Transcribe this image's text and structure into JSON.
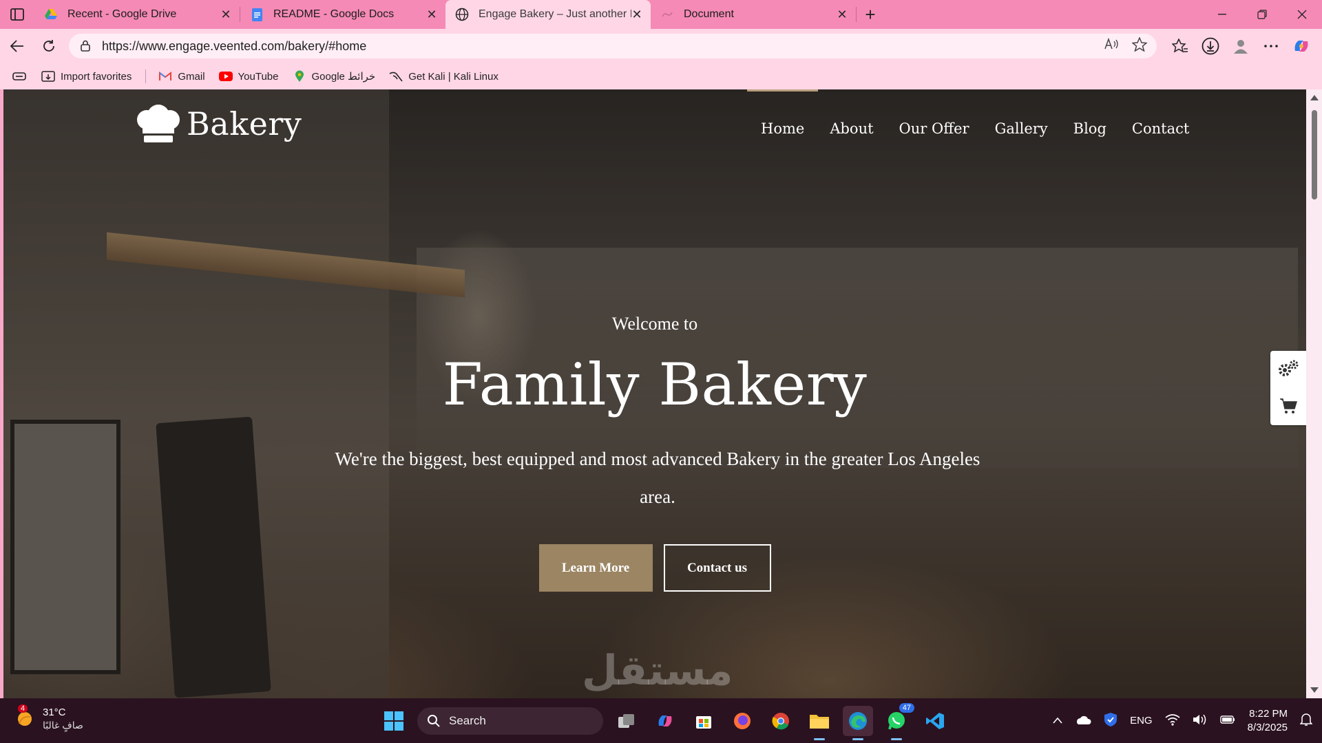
{
  "browser": {
    "tabs": [
      {
        "title": "Recent - Google Drive",
        "icon": "google-drive-icon",
        "active": false
      },
      {
        "title": "README - Google Docs",
        "icon": "google-docs-icon",
        "active": false
      },
      {
        "title": "Engage Bakery – Just another Eng",
        "icon": "globe-icon",
        "active": true
      },
      {
        "title": "Document",
        "icon": "document-icon",
        "active": false
      }
    ],
    "new_tab": "+",
    "address": "https://www.engage.veented.com/bakery/#home",
    "favorites": [
      {
        "label": "Import favorites",
        "icon": "import-icon"
      },
      {
        "label": "Gmail",
        "icon": "gmail-icon"
      },
      {
        "label": "YouTube",
        "icon": "youtube-icon"
      },
      {
        "label": "Google خرائط",
        "icon": "google-maps-icon"
      },
      {
        "label": "Get Kali | Kali Linux",
        "icon": "kali-icon"
      }
    ]
  },
  "site": {
    "brand": "Bakery",
    "nav": [
      "Home",
      "About",
      "Our Offer",
      "Gallery",
      "Blog",
      "Contact"
    ],
    "active_nav": "Home",
    "hero": {
      "welcome": "Welcome to",
      "title": "Family Bakery",
      "description": "We're the biggest, best equipped and most advanced Bakery in the greater Los Angeles area.",
      "learn_more": "Learn More",
      "contact_us": "Contact us"
    },
    "accent_color": "#9c8563",
    "watermark": "مستقل"
  },
  "taskbar": {
    "weather_temp": "31°C",
    "weather_desc": "صافٍ غالبًا",
    "weather_badge": "4",
    "search_placeholder": "Search",
    "whatsapp_badge": "47",
    "lang": "ENG",
    "time": "8:22 PM",
    "date": "8/3/2025"
  },
  "colors": {
    "tabbar": "#f58ab6",
    "toolbar": "#ffd6e6",
    "taskbar": "#2b1220"
  }
}
